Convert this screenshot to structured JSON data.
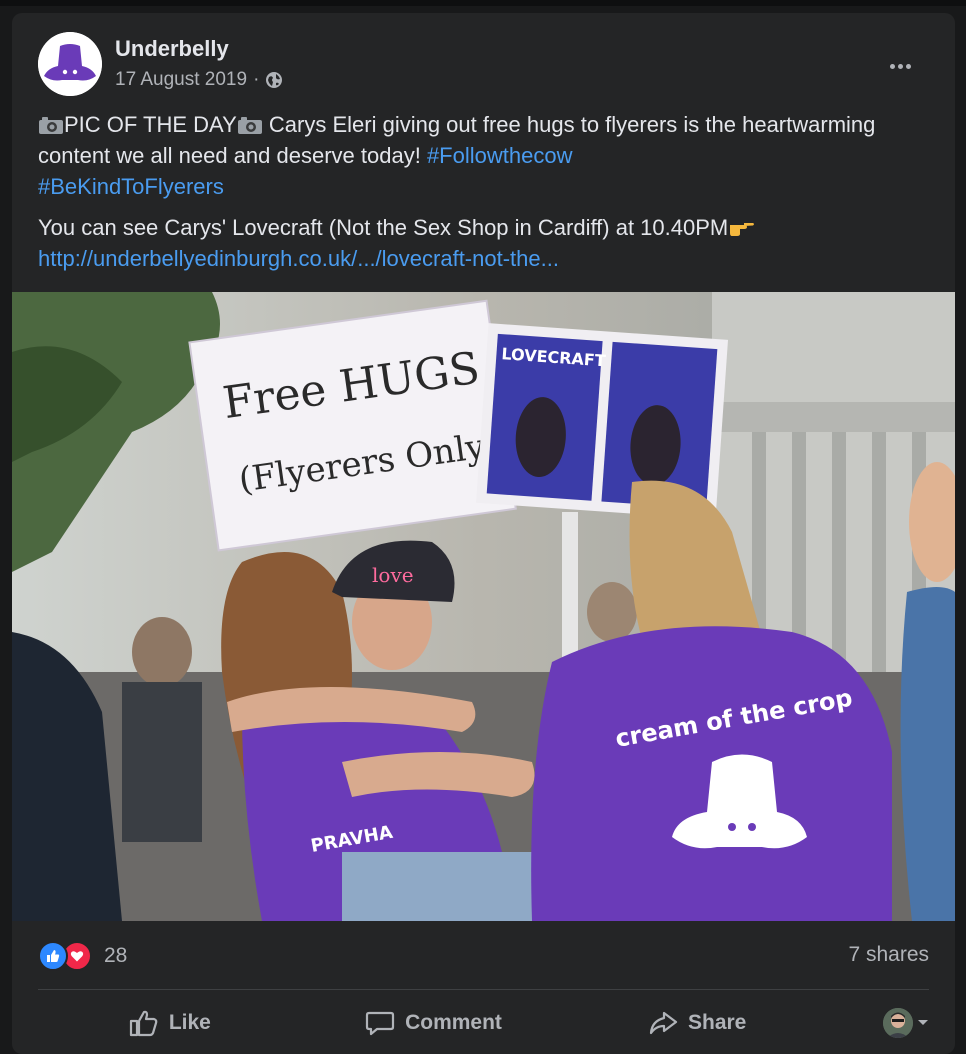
{
  "post": {
    "page_name": "Underbelly",
    "date": "17 August 2019",
    "separator": "·",
    "text": {
      "p1_part1": "PIC OF THE DAY",
      "p1_part2": " Carys Eleri giving out free hugs to flyerers is the heartwarming content we all need and deserve today! ",
      "hashtag1": "#Followthecow",
      "hashtag2": "#BeKindToFlyerers",
      "p2": "You can see Carys' Lovecraft (Not the Sex Shop in Cardiff) at 10.40PM",
      "link": "http://underbellyedinburgh.co.uk/.../lovecraft-not-the..."
    },
    "photo": {
      "sign_line1": "Free HUGS",
      "sign_line2": "(Flyerers Only)",
      "poster_title": "LOVECRAFT",
      "cap_text": "love",
      "sweatshirt_text": "cream of the crop",
      "sweatshirt_small": "PRAVHA"
    }
  },
  "stats": {
    "reaction_count": "28",
    "shares": "7 shares"
  },
  "actions": {
    "like": "Like",
    "comment": "Comment",
    "share": "Share"
  },
  "icons": {
    "camera": "camera-icon",
    "pointing": "pointing-hand-icon",
    "globe": "globe-icon",
    "more": "more-icon"
  },
  "colors": {
    "link": "#4a9cf0",
    "purple": "#6a3bb8",
    "like_blue": "#2d88ff",
    "love_red": "#f02849"
  }
}
